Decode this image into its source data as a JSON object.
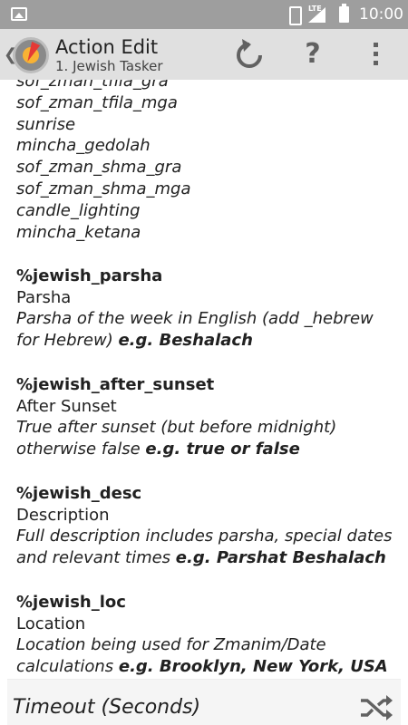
{
  "status_bar": {
    "network": "LTE",
    "time": "10:00"
  },
  "action_bar": {
    "title": "Action Edit",
    "subtitle": "1. Jewish Tasker"
  },
  "variable_list": [
    "sof_zman_tfila_gra",
    "sof_zman_tfila_mga",
    "sunrise",
    "mincha_gedolah",
    "sof_zman_shma_gra",
    "sof_zman_shma_mga",
    "candle_lighting",
    "mincha_ketana"
  ],
  "entries": [
    {
      "name": "%jewish_parsha",
      "label": "Parsha",
      "desc": "Parsha of the week in English (add _hebrew for Hebrew)",
      "example": "e.g. Beshalach"
    },
    {
      "name": "%jewish_after_sunset",
      "label": "After Sunset",
      "desc": "True after sunset (but before midnight) otherwise false",
      "example": "e.g. true or false"
    },
    {
      "name": "%jewish_desc",
      "label": "Description",
      "desc": "Full description includes parsha, special dates and relevant times",
      "example": "e.g. Parshat Beshalach"
    },
    {
      "name": "%jewish_loc",
      "label": "Location",
      "desc": "Location being used for Zmanim/Date calculations",
      "example": "e.g. Brooklyn, New York, USA"
    }
  ],
  "bottom": {
    "timeout_label": "Timeout (Seconds)"
  },
  "icons": {
    "status_left": "image-icon",
    "vibrate": "vibrate-icon",
    "signal": "signal-icon",
    "battery": "battery-icon",
    "back": "chevron-left-icon",
    "app": "tasker-app-icon",
    "refresh": "refresh-icon",
    "help": "help-icon",
    "overflow": "more-vert-icon",
    "shuffle": "shuffle-icon"
  }
}
